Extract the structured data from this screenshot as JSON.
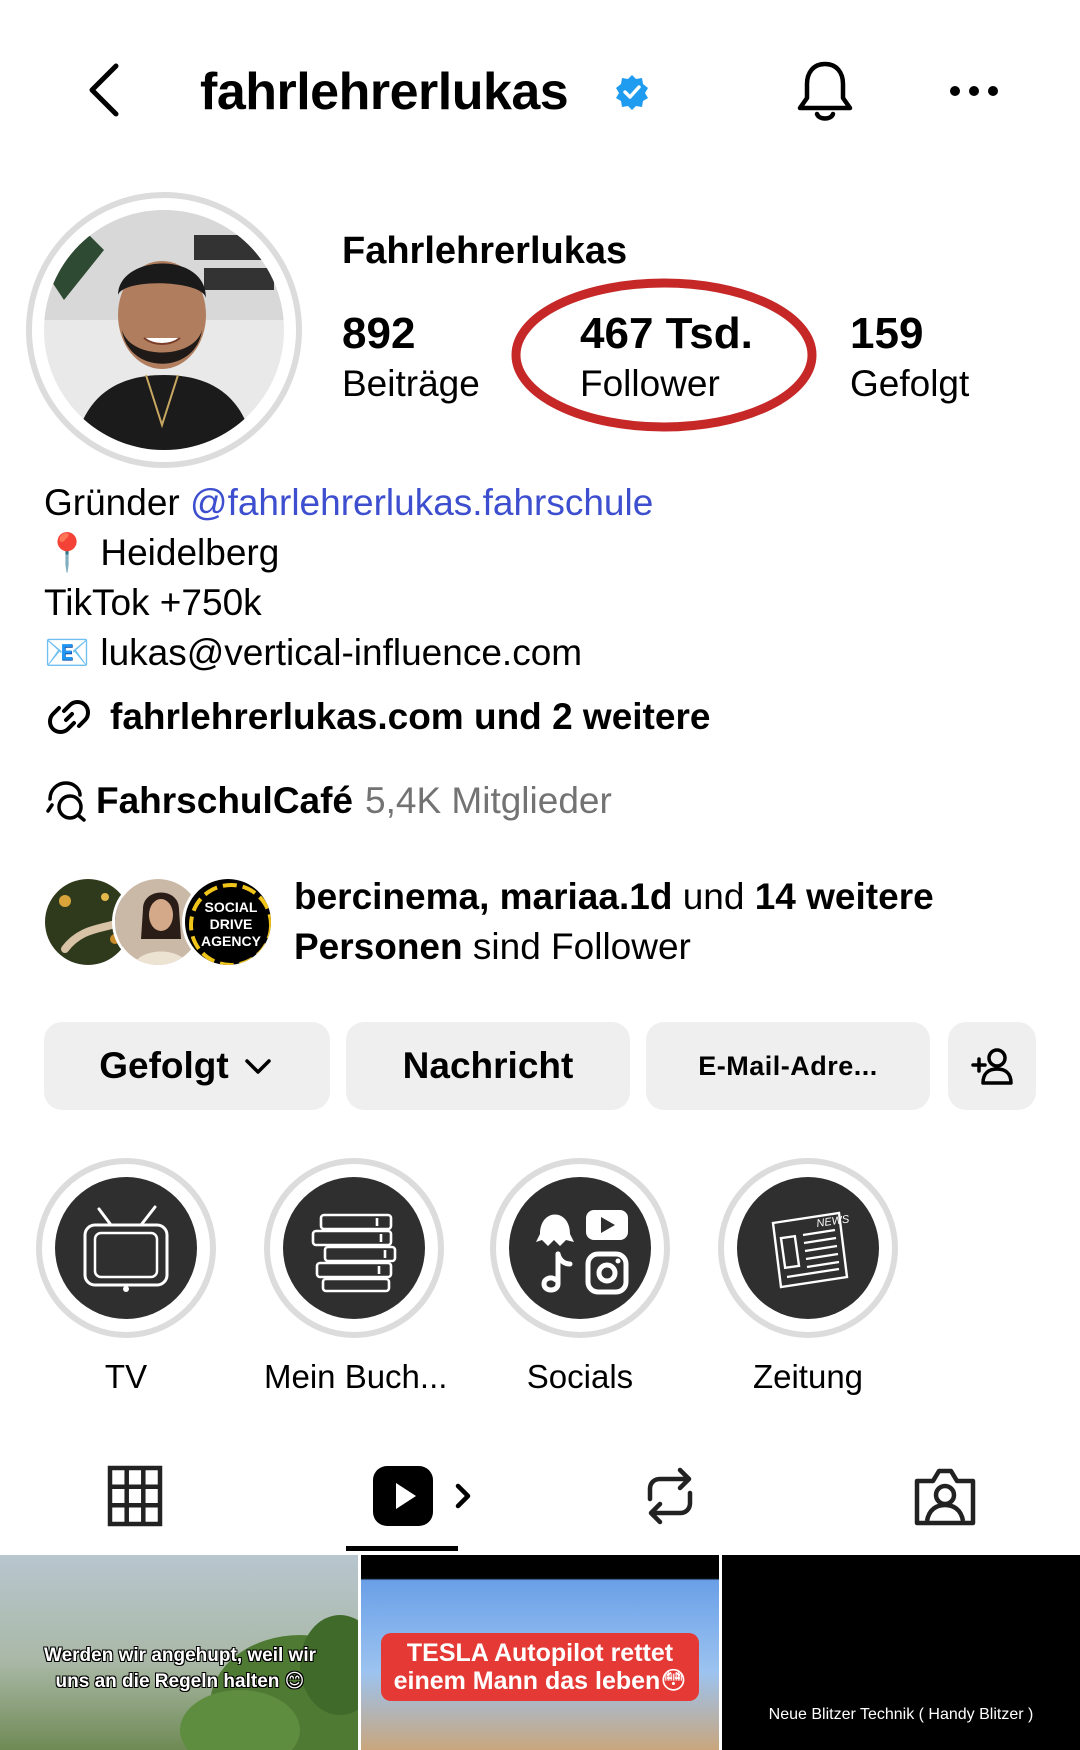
{
  "header": {
    "username": "fahrlehrerlukas",
    "verified": true
  },
  "profile": {
    "display_name": "Fahrlehrerlukas",
    "stats": {
      "posts": {
        "value": "892",
        "label": "Beiträge"
      },
      "followers": {
        "value": "467 Tsd.",
        "label": "Follower"
      },
      "following": {
        "value": "159",
        "label": "Gefolgt"
      }
    },
    "highlight_annotation_color": "#c62828"
  },
  "bio": {
    "founder_prefix": "Gründer ",
    "founder_mention": "@fahrlehrerlukas.fahrschule",
    "location_icon": "📍",
    "location": " Heidelberg",
    "tiktok": "TikTok +750k",
    "email_icon": "📧",
    "email": " lukas@vertical-influence.com",
    "link_text": "fahrlehrerlukas.com und 2 weitere",
    "channel_name": "FahrschulCafé",
    "channel_members": "5,4K Mitglieder",
    "mention_color": "#3d4fcf"
  },
  "followed_by": {
    "names": "bercinema, mariaa.1d",
    "connector": " und ",
    "others": "14 weitere Personen",
    "suffix": " sind Follower",
    "avatar3_text": [
      "SOCIAL",
      "DRIVE",
      "AGENCY"
    ]
  },
  "actions": {
    "follow_label": "Gefolgt",
    "message_label": "Nachricht",
    "email_label": "E-Mail-Adre..."
  },
  "highlights": [
    {
      "label": "TV",
      "icon": "tv-icon"
    },
    {
      "label": "Mein Buch...",
      "icon": "books-icon"
    },
    {
      "label": "Socials",
      "icon": "social-apps-icon"
    },
    {
      "label": "Zeitung",
      "icon": "newspaper-icon"
    }
  ],
  "newspaper_word": "NEWS",
  "tabs": [
    {
      "name": "grid",
      "icon": "grid-icon"
    },
    {
      "name": "reels",
      "icon": "reels-icon",
      "active": true
    },
    {
      "name": "reposts",
      "icon": "repost-icon"
    },
    {
      "name": "tagged",
      "icon": "tagged-icon"
    }
  ],
  "grid": [
    {
      "caption": "Werden wir angehupt, weil wir uns an die Regeln halten 😊"
    },
    {
      "caption": "TESLA Autopilot rettet einem Mann das leben😳"
    },
    {
      "caption": "Neue Blitzer Technik ( Handy Blitzer )"
    }
  ]
}
